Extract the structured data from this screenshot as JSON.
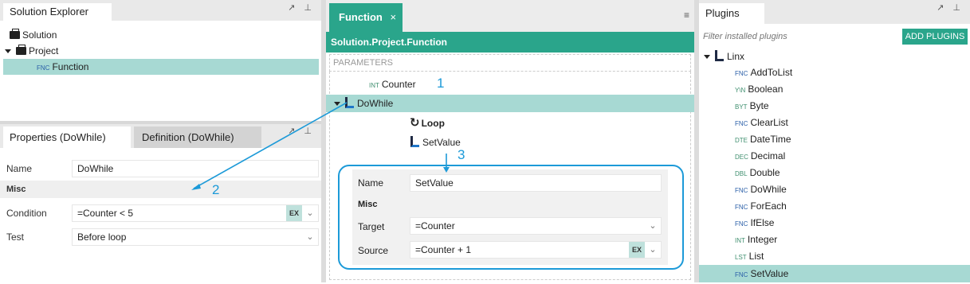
{
  "solution_explorer": {
    "title": "Solution Explorer",
    "items": [
      {
        "label": "Solution"
      },
      {
        "label": "Project"
      },
      {
        "type": "FNC",
        "label": "Function"
      }
    ]
  },
  "properties_panel": {
    "tab_active": "Properties (DoWhile)",
    "tab_inactive": "Definition (DoWhile)",
    "name_label": "Name",
    "name_value": "DoWhile",
    "section_misc": "Misc",
    "condition_label": "Condition",
    "condition_value": "=Counter < 5",
    "test_label": "Test",
    "test_value": "Before loop",
    "ex_badge": "EX"
  },
  "editor": {
    "tab_label": "Function",
    "breadcrumb": "Solution.Project.Function",
    "parameters_label": "PARAMETERS",
    "counter_type": "INT",
    "counter_label": "Counter",
    "dowhile_label": "DoWhile",
    "loop_label": "Loop",
    "setvalue_label": "SetValue",
    "inline_props": {
      "name_label": "Name",
      "name_value": "SetValue",
      "section_misc": "Misc",
      "target_label": "Target",
      "target_value": "=Counter",
      "source_label": "Source",
      "source_value": "=Counter + 1",
      "ex_badge": "EX"
    }
  },
  "callouts": [
    "1",
    "2",
    "3"
  ],
  "plugins": {
    "title": "Plugins",
    "filter_placeholder": "Filter installed plugins",
    "add_button": "ADD PLUGINS",
    "group_label": "Linx",
    "items": [
      {
        "type": "FNC",
        "label": "AddToList"
      },
      {
        "type": "Y\\N",
        "label": "Boolean"
      },
      {
        "type": "BYT",
        "label": "Byte"
      },
      {
        "type": "FNC",
        "label": "ClearList"
      },
      {
        "type": "DTE",
        "label": "DateTime"
      },
      {
        "type": "DEC",
        "label": "Decimal"
      },
      {
        "type": "DBL",
        "label": "Double"
      },
      {
        "type": "FNC",
        "label": "DoWhile"
      },
      {
        "type": "FNC",
        "label": "ForEach"
      },
      {
        "type": "FNC",
        "label": "IfElse"
      },
      {
        "type": "INT",
        "label": "Integer"
      },
      {
        "type": "LST",
        "label": "List"
      },
      {
        "type": "FNC",
        "label": "SetValue"
      }
    ]
  },
  "colors": {
    "accent": "#2aa58b",
    "selection": "#a7d9d3",
    "callout": "#1c9ad8"
  }
}
